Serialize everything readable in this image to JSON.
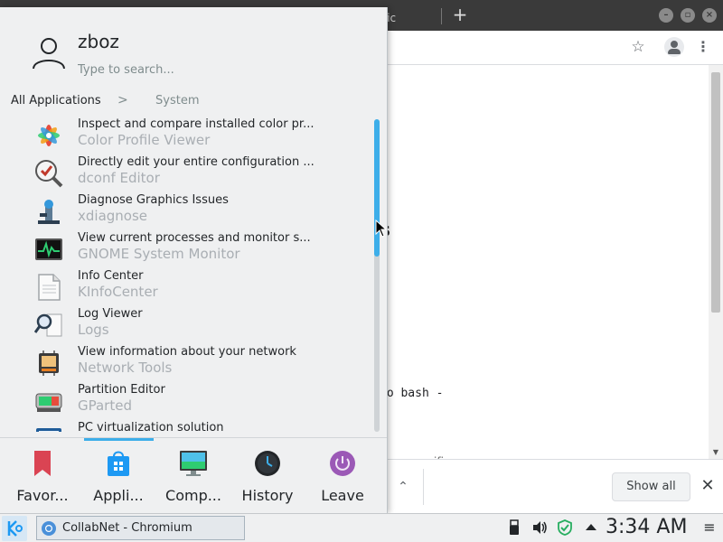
{
  "browser": {
    "tab_partial_text": "fic",
    "new_tab_icon": "plus-icon",
    "page_heading_fragment": "s",
    "page_code_fragment": "do bash -",
    "page_bottom_fragment": "ifi",
    "download_bar": {
      "show_all_label": "Show all",
      "close_glyph": "✕",
      "chevron_glyph": "⌃"
    }
  },
  "launcher": {
    "user_name": "zboz",
    "search_placeholder": "Type to search...",
    "breadcrumb": {
      "root": "All Applications",
      "separator": ">",
      "current": "System"
    },
    "apps": [
      {
        "description": "Inspect and compare installed color pr...",
        "name": "Color Profile Viewer",
        "icon": "color-profile-icon"
      },
      {
        "description": "Directly edit your entire configuration ...",
        "name": "dconf Editor",
        "icon": "dconf-editor-icon"
      },
      {
        "description": "Diagnose Graphics Issues",
        "name": "xdiagnose",
        "icon": "xdiagnose-icon"
      },
      {
        "description": "View current processes and monitor s...",
        "name": "GNOME System Monitor",
        "icon": "system-monitor-icon"
      },
      {
        "description": "Info Center",
        "name": "KInfoCenter",
        "icon": "info-center-icon"
      },
      {
        "description": "Log Viewer",
        "name": "Logs",
        "icon": "logs-icon"
      },
      {
        "description": "View information about your network",
        "name": "Network Tools",
        "icon": "network-tools-icon"
      },
      {
        "description": "Partition Editor",
        "name": "GParted",
        "icon": "gparted-icon"
      },
      {
        "description": "PC virtualization solution",
        "name": "",
        "icon": "virtualization-icon"
      }
    ],
    "footer_tabs": [
      {
        "label": "Favor...",
        "icon": "bookmark-icon"
      },
      {
        "label": "Appli...",
        "icon": "applications-icon"
      },
      {
        "label": "Comp...",
        "icon": "computer-icon"
      },
      {
        "label": "History",
        "icon": "history-icon"
      },
      {
        "label": "Leave",
        "icon": "leave-icon"
      }
    ],
    "active_footer_tab": "Appli...",
    "list_scroll_fraction": 0.44
  },
  "taskbar": {
    "task_label": "CollabNet - Chromium",
    "clock": "3:34 AM",
    "tray_menu_glyph": "≡"
  },
  "colors": {
    "accent": "#3daee9",
    "launcher_bg": "#eff0f1",
    "chrome_tabstrip": "#3a3a3a"
  }
}
